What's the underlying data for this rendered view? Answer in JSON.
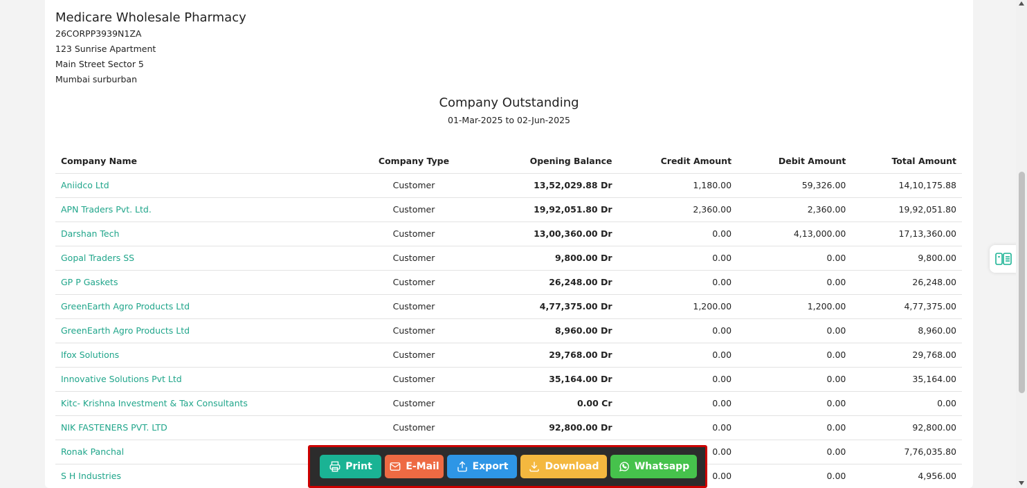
{
  "company": {
    "name": "Medicare Wholesale Pharmacy",
    "gstin": "26CORPP3939N1ZA",
    "address_line1": "123 Sunrise Apartment",
    "address_line2": "Main Street Sector 5",
    "address_line3": "Mumbai surburban"
  },
  "report": {
    "title": "Company Outstanding",
    "range": "01-Mar-2025 to 02-Jun-2025"
  },
  "table": {
    "headers": [
      "Company Name",
      "Company Type",
      "Opening Balance",
      "Credit Amount",
      "Debit Amount",
      "Total Amount"
    ],
    "rows": [
      {
        "name": "Aniidco Ltd",
        "type": "Customer",
        "opening": "13,52,029.88 Dr",
        "credit": "1,180.00",
        "debit": "59,326.00",
        "total": "14,10,175.88"
      },
      {
        "name": "APN Traders Pvt. Ltd.",
        "type": "Customer",
        "opening": "19,92,051.80 Dr",
        "credit": "2,360.00",
        "debit": "2,360.00",
        "total": "19,92,051.80"
      },
      {
        "name": "Darshan Tech",
        "type": "Customer",
        "opening": "13,00,360.00 Dr",
        "credit": "0.00",
        "debit": "4,13,000.00",
        "total": "17,13,360.00"
      },
      {
        "name": "Gopal Traders SS",
        "type": "Customer",
        "opening": "9,800.00 Dr",
        "credit": "0.00",
        "debit": "0.00",
        "total": "9,800.00"
      },
      {
        "name": "GP P Gaskets",
        "type": "Customer",
        "opening": "26,248.00 Dr",
        "credit": "0.00",
        "debit": "0.00",
        "total": "26,248.00"
      },
      {
        "name": "GreenEarth Agro Products Ltd",
        "type": "Customer",
        "opening": "4,77,375.00 Dr",
        "credit": "1,200.00",
        "debit": "1,200.00",
        "total": "4,77,375.00"
      },
      {
        "name": "GreenEarth Agro Products Ltd",
        "type": "Customer",
        "opening": "8,960.00 Dr",
        "credit": "0.00",
        "debit": "0.00",
        "total": "8,960.00"
      },
      {
        "name": "Ifox Solutions",
        "type": "Customer",
        "opening": "29,768.00 Dr",
        "credit": "0.00",
        "debit": "0.00",
        "total": "29,768.00"
      },
      {
        "name": "Innovative Solutions Pvt Ltd",
        "type": "Customer",
        "opening": "35,164.00 Dr",
        "credit": "0.00",
        "debit": "0.00",
        "total": "35,164.00"
      },
      {
        "name": "Kitc- Krishna Investment & Tax Consultants",
        "type": "Customer",
        "opening": "0.00 Cr",
        "credit": "0.00",
        "debit": "0.00",
        "total": "0.00"
      },
      {
        "name": "NIK FASTENERS PVT. LTD",
        "type": "Customer",
        "opening": "92,800.00 Dr",
        "credit": "0.00",
        "debit": "0.00",
        "total": "92,800.00"
      },
      {
        "name": "Ronak Panchal",
        "type": "",
        "opening": "",
        "credit": "0.00",
        "debit": "0.00",
        "total": "7,76,035.80"
      },
      {
        "name": "S H Industries",
        "type": "",
        "opening": "",
        "credit": "0.00",
        "debit": "0.00",
        "total": "4,956.00"
      }
    ]
  },
  "actions": {
    "print": "Print",
    "email": "E-Mail",
    "export": "Export",
    "download": "Download",
    "whatsapp": "Whatsapp"
  },
  "icons": {
    "print": "printer-icon",
    "email": "mail-icon",
    "export": "upload-icon",
    "download": "download-icon",
    "whatsapp": "whatsapp-icon",
    "side": "report-list-icon"
  },
  "colors": {
    "link": "#1fa58a",
    "print": "#1ab394",
    "email": "#ee6a43",
    "export": "#2e96e6",
    "download": "#f4b83f",
    "whatsapp": "#46c24c",
    "highlight": "#cc0000"
  }
}
